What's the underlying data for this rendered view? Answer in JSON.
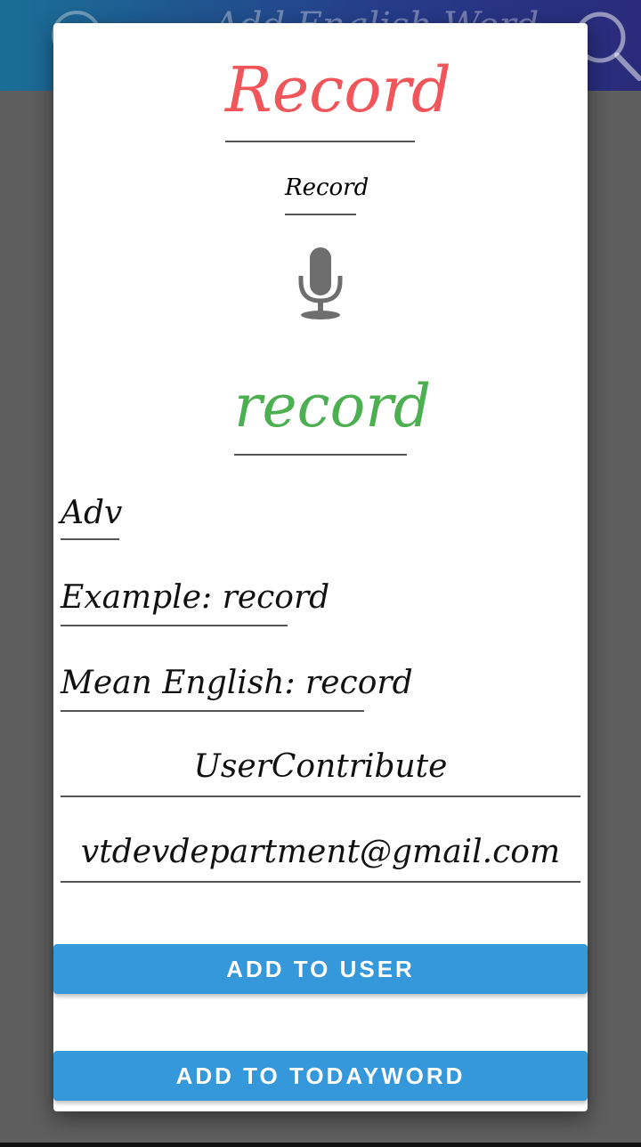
{
  "app_bar": {
    "title": "Add English Word",
    "left_icon": "circle-icon",
    "search_icon": "search-icon"
  },
  "dialog": {
    "title": "Record",
    "subtitle": "Record",
    "mic_icon": "microphone-icon",
    "word": "record",
    "part_of_speech": "Adv",
    "example": "Example: record",
    "mean_english": "Mean English: record",
    "user_contribute": "UserContribute",
    "email": "vtdevdepartment@gmail.com",
    "buttons": {
      "add_to_user": "ADD TO USER",
      "add_to_todayword": "ADD TO TODAYWORD"
    }
  },
  "colors": {
    "title": "#f0555a",
    "word": "#4caf50",
    "button": "#3498db",
    "overlay": "#5e5e5e"
  }
}
